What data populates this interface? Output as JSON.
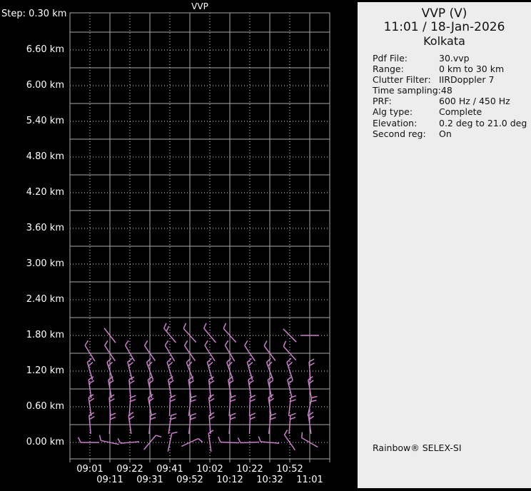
{
  "colors": {
    "background": "#000000",
    "panel_bg": "#ededed",
    "grid_solid": "#a8a8a8",
    "grid_dotted": "#d9d9d9",
    "axis_text": "#ffffff",
    "barb": "#cc7fcc",
    "panel_text": "#111111"
  },
  "chart": {
    "title": "VVP",
    "step_label": "Step: 0.30 km",
    "y_axis": {
      "labels": [
        "6.60 km",
        "6.00 km",
        "5.40 km",
        "4.80 km",
        "4.20 km",
        "3.60 km",
        "3.00 km",
        "2.40 km",
        "1.80 km",
        "1.20 km",
        "0.60 km",
        "0.00 km"
      ]
    },
    "x_axis": {
      "labels_row1": [
        "09:01",
        "09:22",
        "09:41",
        "10:02",
        "10:22",
        "10:52"
      ],
      "labels_row2": [
        "09:11",
        "09:31",
        "09:52",
        "10:12",
        "10:32",
        "11:01"
      ]
    }
  },
  "chart_data": {
    "type": "wind-barb-time-height-profile",
    "title": "VVP",
    "x_times": [
      "09:01",
      "09:11",
      "09:22",
      "09:31",
      "09:41",
      "09:52",
      "10:02",
      "10:12",
      "10:22",
      "10:32",
      "10:52",
      "11:01"
    ],
    "y_unit": "km",
    "y_step_km": 0.3,
    "y_labeled_interval_km": 0.6,
    "ylim_km": [
      0.0,
      7.2
    ],
    "grid": "solid lines at odd 0.3 km multiples, dotted lines at 0.6 km multiples; vertical lines alternate dotted/solid per scan time",
    "barb_note": "each entry = [time_index, height_km, staff_angle_deg_cw_from_up, feather_tick_count]",
    "barbs": [
      [
        0,
        0,
        -90,
        1
      ],
      [
        1,
        0,
        -78,
        1
      ],
      [
        2,
        0,
        -95,
        1
      ],
      [
        3,
        0,
        40,
        1
      ],
      [
        4,
        0,
        12,
        1
      ],
      [
        5,
        0,
        65,
        1
      ],
      [
        6,
        0,
        -8,
        1
      ],
      [
        7,
        0,
        -88,
        1
      ],
      [
        8,
        0,
        -92,
        1
      ],
      [
        9,
        0,
        -85,
        1
      ],
      [
        10,
        0,
        -35,
        1
      ],
      [
        11,
        0,
        -60,
        1
      ],
      [
        0,
        0.3,
        -5,
        2
      ],
      [
        1,
        0.3,
        3,
        2
      ],
      [
        2,
        0.3,
        -8,
        2
      ],
      [
        3,
        0.3,
        5,
        2
      ],
      [
        4,
        0.3,
        8,
        2
      ],
      [
        5,
        0.3,
        6,
        2
      ],
      [
        6,
        0.3,
        -4,
        2
      ],
      [
        7,
        0.3,
        4,
        2
      ],
      [
        8,
        0.3,
        2,
        2
      ],
      [
        9,
        0.3,
        6,
        2
      ],
      [
        10,
        0.3,
        4,
        2
      ],
      [
        11,
        0.3,
        -8,
        2
      ],
      [
        0,
        0.6,
        -8,
        2
      ],
      [
        1,
        0.6,
        -4,
        2
      ],
      [
        2,
        0.6,
        4,
        2
      ],
      [
        3,
        0.6,
        -10,
        2
      ],
      [
        4,
        0.6,
        2,
        2
      ],
      [
        5,
        0.6,
        7,
        2
      ],
      [
        6,
        0.6,
        -6,
        2
      ],
      [
        7,
        0.6,
        4,
        2
      ],
      [
        8,
        0.6,
        2,
        2
      ],
      [
        9,
        0.6,
        -8,
        2
      ],
      [
        10,
        0.6,
        6,
        2
      ],
      [
        11,
        0.6,
        12,
        2
      ],
      [
        0,
        0.9,
        -8,
        2
      ],
      [
        1,
        0.9,
        -10,
        2
      ],
      [
        2,
        0.9,
        -5,
        2
      ],
      [
        3,
        0.9,
        -12,
        2
      ],
      [
        4,
        0.9,
        -10,
        2
      ],
      [
        5,
        0.9,
        -8,
        2
      ],
      [
        6,
        0.9,
        -6,
        2
      ],
      [
        7,
        0.9,
        -10,
        2
      ],
      [
        8,
        0.9,
        -9,
        2
      ],
      [
        9,
        0.9,
        -12,
        2
      ],
      [
        10,
        0.9,
        -14,
        2
      ],
      [
        11,
        0.9,
        -10,
        2
      ],
      [
        0,
        1.2,
        -16,
        2
      ],
      [
        1,
        1.2,
        -18,
        2
      ],
      [
        2,
        1.2,
        -14,
        2
      ],
      [
        3,
        1.2,
        -20,
        2
      ],
      [
        4,
        1.2,
        -17,
        2
      ],
      [
        5,
        1.2,
        -21,
        2
      ],
      [
        6,
        1.2,
        -16,
        2
      ],
      [
        7,
        1.2,
        -19,
        2
      ],
      [
        8,
        1.2,
        -16,
        2
      ],
      [
        9,
        1.2,
        -20,
        2
      ],
      [
        10,
        1.2,
        -18,
        2
      ],
      [
        11,
        1.2,
        -4,
        2
      ],
      [
        0,
        1.5,
        -32,
        1
      ],
      [
        1,
        1.5,
        -34,
        1
      ],
      [
        2,
        1.5,
        -30,
        1
      ],
      [
        3,
        1.5,
        -35,
        1
      ],
      [
        4,
        1.5,
        -31,
        1
      ],
      [
        5,
        1.5,
        -35,
        1
      ],
      [
        6,
        1.5,
        -33,
        1
      ],
      [
        7,
        1.5,
        -31,
        1
      ],
      [
        8,
        1.5,
        -34,
        1
      ],
      [
        9,
        1.5,
        -37,
        1
      ],
      [
        10,
        1.5,
        -42,
        1
      ],
      [
        1,
        1.8,
        -38,
        0
      ],
      [
        4,
        1.8,
        -40,
        2
      ],
      [
        5,
        1.8,
        -42,
        1
      ],
      [
        6,
        1.8,
        -40,
        1
      ],
      [
        7,
        1.8,
        -42,
        1
      ],
      [
        10,
        1.8,
        -45,
        0
      ],
      [
        11,
        1.8,
        -90,
        0
      ]
    ]
  },
  "panel": {
    "title": "VVP (V)",
    "datetime": "11:01 / 18-Jan-2026",
    "site": "Kolkata",
    "fields": [
      {
        "label": "Pdf File:",
        "value": "30.vvp"
      },
      {
        "label": "Range:",
        "value": "0 km to 30 km"
      },
      {
        "label": "Clutter Filter:",
        "value": "IIRDoppler 7"
      },
      {
        "label": "Time sampling:",
        "value": "48"
      },
      {
        "label": "PRF:",
        "value": "600 Hz / 450 Hz"
      },
      {
        "label": "Alg type:",
        "value": "Complete"
      },
      {
        "label": "Elevation:",
        "value": "0.2 deg to 21.0 deg"
      },
      {
        "label": "Second reg:",
        "value": "On"
      }
    ],
    "footer": "Rainbow® SELEX-SI"
  }
}
